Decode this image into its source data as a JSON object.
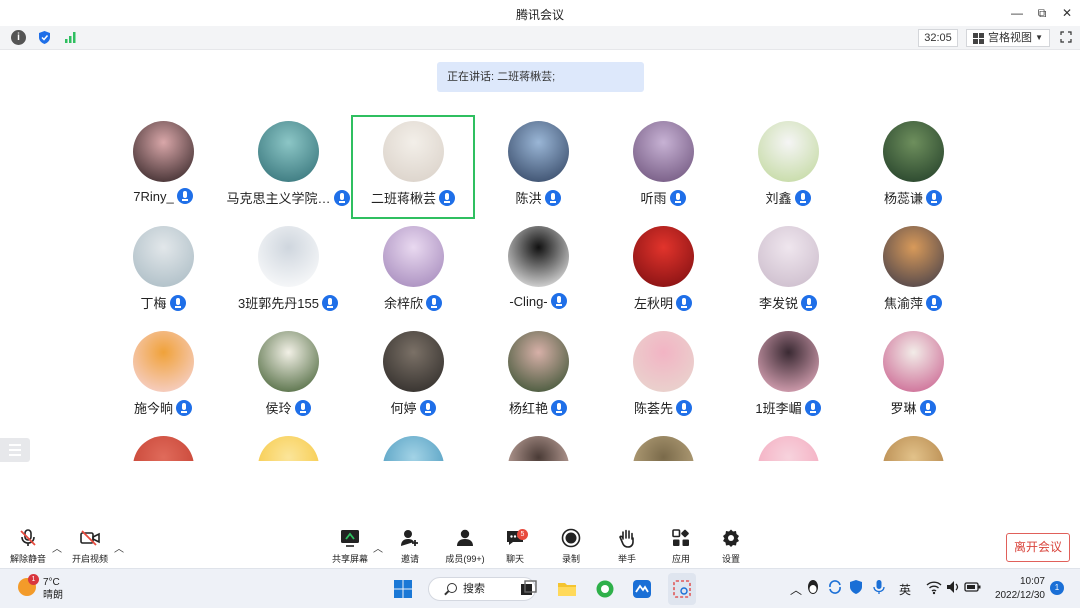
{
  "window": {
    "title": "腾讯会议",
    "controls": {
      "minimize": "—",
      "restore": "⧉",
      "close": "✕"
    }
  },
  "toolbar": {
    "timer": "32:05",
    "view_label": "宫格视图",
    "info_glyph": "i"
  },
  "speaking_banner": "正在讲话: 二班蒋楸芸;",
  "participants": [
    {
      "name": "7Riny_",
      "avatar": "portrait-dark",
      "colors": [
        "#2a1d1f",
        "#d9a7a9"
      ]
    },
    {
      "name": "马克思主义学院…",
      "avatar": "cartoon-teal",
      "colors": [
        "#2f6d74",
        "#8cc6c6"
      ]
    },
    {
      "name": "二班蒋楸芸",
      "avatar": "room-photo",
      "colors": [
        "#d8cfc6",
        "#f3efe9"
      ],
      "active": true
    },
    {
      "name": "陈洪",
      "avatar": "man-photo",
      "colors": [
        "#2d3f5d",
        "#9ab6d6"
      ]
    },
    {
      "name": "听雨",
      "avatar": "field-photo",
      "colors": [
        "#6a4f78",
        "#c7b2d4"
      ]
    },
    {
      "name": "刘鑫",
      "avatar": "panda-cartoon",
      "colors": [
        "#bfd79a",
        "#f5f5f5"
      ]
    },
    {
      "name": "杨蕊谦",
      "avatar": "outdoor-photo",
      "colors": [
        "#1f3b26",
        "#6e8f5d"
      ]
    },
    {
      "name": "丁梅",
      "avatar": "grey-hair-photo",
      "colors": [
        "#a7b9c2",
        "#e2e7ea"
      ]
    },
    {
      "name": "3班郭先丹155",
      "avatar": "sketch-girl",
      "colors": [
        "#ffffff",
        "#cfd6de"
      ]
    },
    {
      "name": "余梓欣",
      "avatar": "purple-photo",
      "colors": [
        "#a084b8",
        "#e9d9f0"
      ]
    },
    {
      "name": "-Cling-",
      "avatar": "cat-cartoon",
      "colors": [
        "#ffffff",
        "#111111"
      ]
    },
    {
      "name": "左秋明",
      "avatar": "lanterns",
      "colors": [
        "#7a0d10",
        "#e2342c"
      ]
    },
    {
      "name": "李发锐",
      "avatar": "anime-boy",
      "colors": [
        "#c9b9c9",
        "#efe6ee"
      ]
    },
    {
      "name": "焦渝萍",
      "avatar": "city-night",
      "colors": [
        "#3d3a49",
        "#d89a5a"
      ]
    },
    {
      "name": "施今晌",
      "avatar": "shiba-cartoon",
      "colors": [
        "#f7d7df",
        "#f0a23a"
      ]
    },
    {
      "name": "侯玲",
      "avatar": "flower-photo",
      "colors": [
        "#3c5a2c",
        "#f2f0e6"
      ]
    },
    {
      "name": "何婷",
      "avatar": "dark-still",
      "colors": [
        "#2a2725",
        "#7b7167"
      ]
    },
    {
      "name": "杨红艳",
      "avatar": "girl-flowers",
      "colors": [
        "#2f4b2a",
        "#d7b0a8"
      ]
    },
    {
      "name": "陈荟先",
      "avatar": "kitten-bunny",
      "colors": [
        "#e8d8cf",
        "#f2b4c4"
      ]
    },
    {
      "name": "1班李嵋",
      "avatar": "silhouette-pink",
      "colors": [
        "#f2b6c9",
        "#3a2a33"
      ]
    },
    {
      "name": "罗琳",
      "avatar": "cat-curlers",
      "colors": [
        "#c85a8a",
        "#f2ece8"
      ]
    }
  ],
  "partial_row": [
    {
      "colors": [
        "#c0392b",
        "#e06b5b"
      ]
    },
    {
      "colors": [
        "#f6c232",
        "#fbe59a"
      ]
    },
    {
      "colors": [
        "#3b8fb7",
        "#a3d3e6"
      ]
    },
    {
      "colors": [
        "#e9c9c0",
        "#4a3b36"
      ]
    },
    {
      "colors": [
        "#c9b48a",
        "#7a6a4a"
      ]
    },
    {
      "colors": [
        "#f3a1b8",
        "#f7d3dd"
      ]
    },
    {
      "colors": [
        "#a8763a",
        "#e2c28a"
      ]
    }
  ],
  "controls": {
    "mute": "解除静音",
    "video": "开启视频",
    "share": "共享屏幕",
    "invite": "邀请",
    "members": "成员(99+)",
    "chat": "聊天",
    "chat_badge": "5",
    "record": "录制",
    "raise_hand": "举手",
    "apps": "应用",
    "settings": "设置",
    "leave": "离开会议"
  },
  "taskbar": {
    "weather_temp": "7°C",
    "weather_desc": "晴朗",
    "weather_badge": "1",
    "search": "搜索",
    "ime": "英",
    "time": "10:07",
    "date": "2022/12/30",
    "notif_count": "1"
  },
  "colors": {
    "accent": "#1f6fe8",
    "active_border": "#2fbf60",
    "leave": "#d9443c",
    "banner": "#dde8fb"
  }
}
